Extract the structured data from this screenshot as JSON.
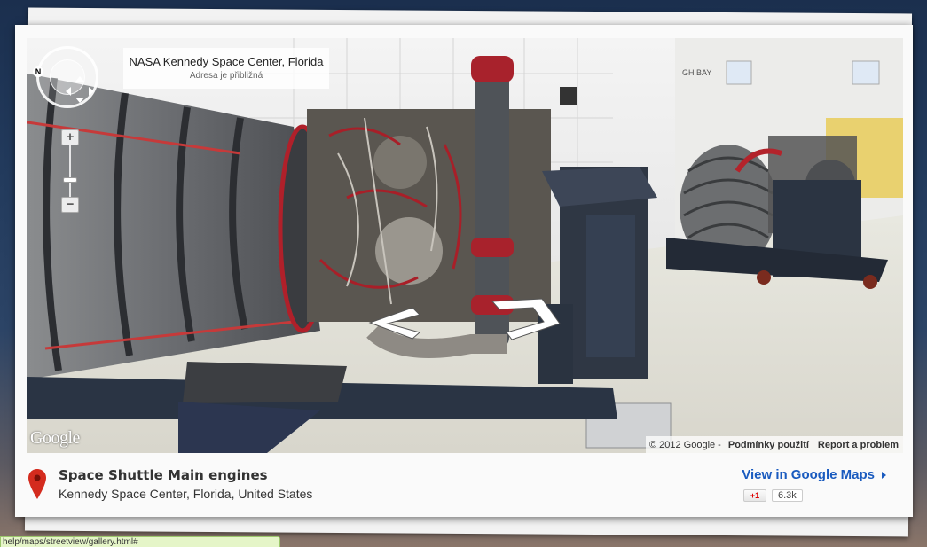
{
  "streetview": {
    "location_title": "NASA Kennedy Space Center, Florida",
    "location_subtitle": "Adresa je přibližná",
    "north_label": "N",
    "zoom_in_label": "+",
    "zoom_out_label": "−",
    "zoom_level_fraction": 0.3,
    "scene_sign_text": "GH BAY",
    "google_logo": "Google",
    "copyright": "© 2012 Google -",
    "terms_link": "Podmínky použití",
    "report_link": "Report a problem"
  },
  "place": {
    "title": "Space Shuttle Main engines",
    "address": "Kennedy Space Center, Florida, United States",
    "view_link": "View in Google Maps",
    "gplus_label": "+1",
    "gplus_count": "6.3k"
  },
  "status_bar": {
    "url": "help/maps/streetview/gallery.html#"
  },
  "colors": {
    "link": "#1a5bbf",
    "pin": "#d42b1e",
    "background": "#1b2f4e"
  }
}
